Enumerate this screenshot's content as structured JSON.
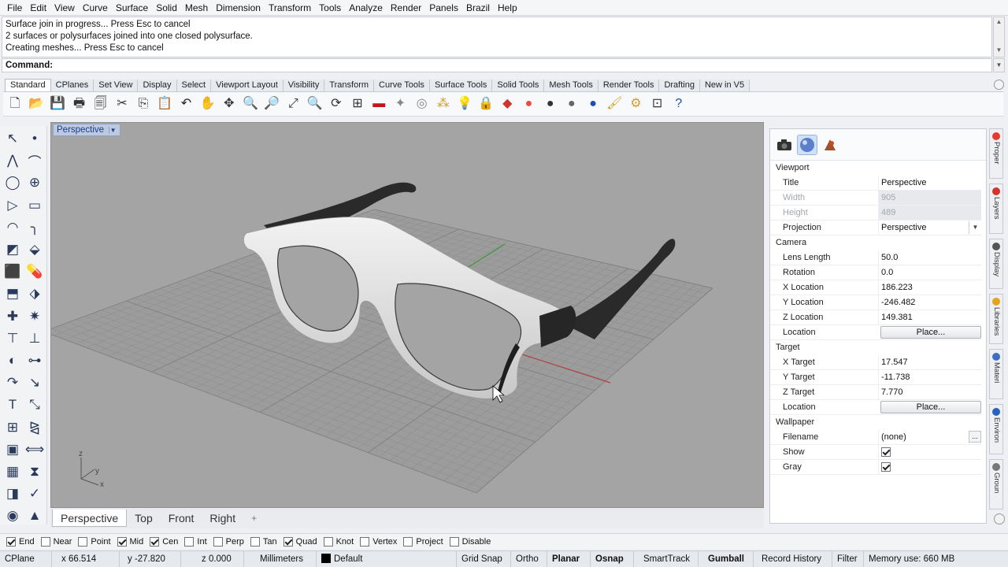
{
  "menu": [
    "File",
    "Edit",
    "View",
    "Curve",
    "Surface",
    "Solid",
    "Mesh",
    "Dimension",
    "Transform",
    "Tools",
    "Analyze",
    "Render",
    "Panels",
    "Brazil",
    "Help"
  ],
  "command_history": [
    "Surface join in progress... Press Esc to cancel",
    "2 surfaces or polysurfaces joined into one closed polysurface.",
    "Creating meshes... Press Esc to cancel"
  ],
  "command_prompt": "Command:",
  "toolbar_tabs": [
    "Standard",
    "CPlanes",
    "Set View",
    "Display",
    "Select",
    "Viewport Layout",
    "Visibility",
    "Transform",
    "Curve Tools",
    "Surface Tools",
    "Solid Tools",
    "Mesh Tools",
    "Render Tools",
    "Drafting",
    "New in V5"
  ],
  "toolbar_icons": [
    {
      "name": "new-icon",
      "glyph": "🗋",
      "color": "#333"
    },
    {
      "name": "open-icon",
      "glyph": "📂",
      "color": "#d9a421"
    },
    {
      "name": "save-icon",
      "glyph": "💾",
      "color": "#333"
    },
    {
      "name": "print-icon",
      "glyph": "🖶",
      "color": "#333"
    },
    {
      "name": "import-icon",
      "glyph": "🗐",
      "color": "#333"
    },
    {
      "name": "cut-icon",
      "glyph": "✂",
      "color": "#333"
    },
    {
      "name": "copy-icon",
      "glyph": "⎘",
      "color": "#333"
    },
    {
      "name": "paste-icon",
      "glyph": "📋",
      "color": "#b58a1c"
    },
    {
      "name": "undo-icon",
      "glyph": "↶",
      "color": "#222"
    },
    {
      "name": "pan-icon",
      "glyph": "✋",
      "color": "#333"
    },
    {
      "name": "move-view-icon",
      "glyph": "✥",
      "color": "#333"
    },
    {
      "name": "zoom-icon",
      "glyph": "🔍",
      "color": "#333"
    },
    {
      "name": "zoom-window-icon",
      "glyph": "🔎",
      "color": "#333"
    },
    {
      "name": "zoom-extents-icon",
      "glyph": "⤢",
      "color": "#333"
    },
    {
      "name": "zoom-selected-icon",
      "glyph": "🔍",
      "color": "#d9a421"
    },
    {
      "name": "rotate-view-icon",
      "glyph": "⟳",
      "color": "#333"
    },
    {
      "name": "viewport-layout-icon",
      "glyph": "⊞",
      "color": "#333"
    },
    {
      "name": "cplane-icon",
      "glyph": "▬",
      "color": "#c3161c"
    },
    {
      "name": "point-icon",
      "glyph": "✦",
      "color": "#888"
    },
    {
      "name": "snap-icon",
      "glyph": "◎",
      "color": "#888"
    },
    {
      "name": "grid-snap-icon",
      "glyph": "⁂",
      "color": "#c9a227"
    },
    {
      "name": "light-icon",
      "glyph": "💡",
      "color": "#bbb"
    },
    {
      "name": "lock-icon",
      "glyph": "🔒",
      "color": "#555"
    },
    {
      "name": "layer-color-icon",
      "glyph": "◆",
      "color": "#d0342c"
    },
    {
      "name": "color-wheel-icon",
      "glyph": "●",
      "color": "#e94b3c"
    },
    {
      "name": "wireframe-sphere-icon",
      "glyph": "●",
      "color": "#333"
    },
    {
      "name": "shaded-sphere-icon",
      "glyph": "●",
      "color": "#666"
    },
    {
      "name": "render-sphere-icon",
      "glyph": "●",
      "color": "#1f4fb0"
    },
    {
      "name": "material-icon",
      "glyph": "🖌",
      "color": "#c9a227"
    },
    {
      "name": "options-icon",
      "glyph": "⚙",
      "color": "#c9a227"
    },
    {
      "name": "dimension-icon",
      "glyph": "⊡",
      "color": "#333"
    },
    {
      "name": "help-icon",
      "glyph": "?",
      "color": "#1f4fb0"
    }
  ],
  "left_tools": [
    {
      "name": "select-icon",
      "glyph": "↖"
    },
    {
      "name": "point-tool-icon",
      "glyph": "•"
    },
    {
      "name": "polyline-icon",
      "glyph": "⋀"
    },
    {
      "name": "curve-control-icon",
      "glyph": "⌒"
    },
    {
      "name": "circle-icon",
      "glyph": "◯"
    },
    {
      "name": "ellipse-icon",
      "glyph": "⊕"
    },
    {
      "name": "polygon-icon",
      "glyph": "▷"
    },
    {
      "name": "rectangle-icon",
      "glyph": "▭"
    },
    {
      "name": "arc-icon",
      "glyph": "◠"
    },
    {
      "name": "fillet-curve-icon",
      "glyph": "╮"
    },
    {
      "name": "surface-corner-icon",
      "glyph": "◩"
    },
    {
      "name": "surface-extrude-icon",
      "glyph": "⬙"
    },
    {
      "name": "box-icon",
      "glyph": "⬛"
    },
    {
      "name": "pill-icon",
      "glyph": "💊"
    },
    {
      "name": "mesh-icon",
      "glyph": "⬒"
    },
    {
      "name": "mesh-plane-icon",
      "glyph": "⬗"
    },
    {
      "name": "light-tool-icon",
      "glyph": "✚"
    },
    {
      "name": "explode-icon",
      "glyph": "✷"
    },
    {
      "name": "trim-icon",
      "glyph": "⊤"
    },
    {
      "name": "split-icon",
      "glyph": "⊥"
    },
    {
      "name": "boolean-icon",
      "glyph": "◐"
    },
    {
      "name": "group-icon",
      "glyph": "⊶"
    },
    {
      "name": "move-icon",
      "glyph": "↷"
    },
    {
      "name": "bend-icon",
      "glyph": "↘"
    },
    {
      "name": "text-icon",
      "glyph": "T"
    },
    {
      "name": "scale-icon",
      "glyph": "⤡"
    },
    {
      "name": "array-icon",
      "glyph": "⊞"
    },
    {
      "name": "mirror-icon",
      "glyph": "⧎"
    },
    {
      "name": "solid-box-icon",
      "glyph": "▣"
    },
    {
      "name": "dimension-tool-icon",
      "glyph": "⟺"
    },
    {
      "name": "grid-array-icon",
      "glyph": "▦"
    },
    {
      "name": "fuel-icon",
      "glyph": "⧗"
    },
    {
      "name": "analyze-icon",
      "glyph": "◨"
    },
    {
      "name": "check-icon",
      "glyph": "✓"
    },
    {
      "name": "render-tool-icon",
      "glyph": "◉"
    },
    {
      "name": "paint-icon",
      "glyph": "▲"
    }
  ],
  "viewport": {
    "title": "Perspective",
    "axis_z": "z",
    "axis_y": "y",
    "axis_x": "x"
  },
  "viewport_tabs": [
    "Perspective",
    "Top",
    "Front",
    "Right"
  ],
  "viewport_add": "+",
  "properties": {
    "viewport_section": "Viewport",
    "title_label": "Title",
    "title_value": "Perspective",
    "width_label": "Width",
    "width_value": "905",
    "height_label": "Height",
    "height_value": "489",
    "projection_label": "Projection",
    "projection_value": "Perspective",
    "camera_section": "Camera",
    "lens_label": "Lens Length",
    "lens_value": "50.0",
    "rotation_label": "Rotation",
    "rotation_value": "0.0",
    "xloc_label": "X Location",
    "xloc_value": "186.223",
    "yloc_label": "Y Location",
    "yloc_value": "-246.482",
    "zloc_label": "Z Location",
    "zloc_value": "149.381",
    "location_label": "Location",
    "place_label": "Place...",
    "target_section": "Target",
    "xt_label": "X Target",
    "xt_value": "17.547",
    "yt_label": "Y Target",
    "yt_value": "-11.738",
    "zt_label": "Z Target",
    "zt_value": "7.770",
    "tloc_label": "Location",
    "tplace_label": "Place...",
    "wallpaper_section": "Wallpaper",
    "filename_label": "Filename",
    "filename_value": "(none)",
    "show_label": "Show",
    "show_checked": true,
    "gray_label": "Gray",
    "gray_checked": true
  },
  "side_tabs": [
    {
      "label": "Proper",
      "color": "#e53b2f"
    },
    {
      "label": "Layers",
      "color": "#d0342c"
    },
    {
      "label": "Display",
      "color": "#555"
    },
    {
      "label": "Libraries",
      "color": "#e3a51d"
    },
    {
      "label": "Materi",
      "color": "#3f6fc4"
    },
    {
      "label": "Environ",
      "color": "#2a60c0"
    },
    {
      "label": "Groun",
      "color": "#777"
    }
  ],
  "osnaps": [
    {
      "label": "End",
      "checked": true
    },
    {
      "label": "Near",
      "checked": false
    },
    {
      "label": "Point",
      "checked": false
    },
    {
      "label": "Mid",
      "checked": true
    },
    {
      "label": "Cen",
      "checked": true
    },
    {
      "label": "Int",
      "checked": false
    },
    {
      "label": "Perp",
      "checked": false
    },
    {
      "label": "Tan",
      "checked": false
    },
    {
      "label": "Quad",
      "checked": true
    },
    {
      "label": "Knot",
      "checked": false
    },
    {
      "label": "Vertex",
      "checked": false
    },
    {
      "label": "Project",
      "checked": false
    },
    {
      "label": "Disable",
      "checked": false
    }
  ],
  "status": {
    "cplane": "CPlane",
    "x": "x 66.514",
    "y": "y -27.820",
    "z": "z 0.000",
    "units": "Millimeters",
    "layer": "Default",
    "grid_snap": "Grid Snap",
    "ortho": "Ortho",
    "planar": "Planar",
    "osnap": "Osnap",
    "smarttrack": "SmartTrack",
    "gumball": "Gumball",
    "record_history": "Record History",
    "filter": "Filter",
    "memory": "Memory use: 660 MB"
  }
}
